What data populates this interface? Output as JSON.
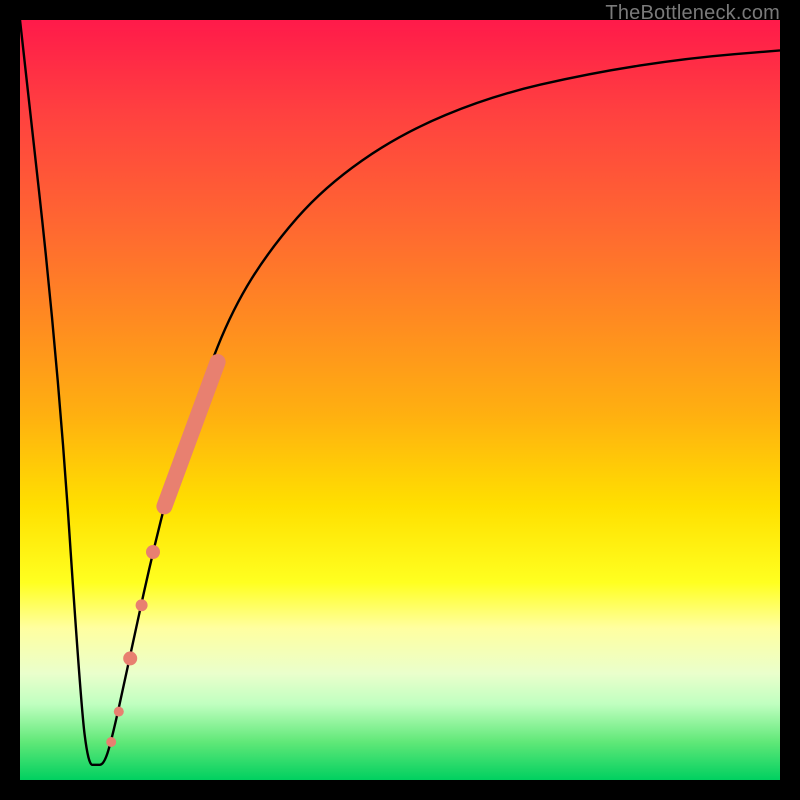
{
  "watermark": {
    "text": "TheBottleneck.com"
  },
  "colors": {
    "curve": "#000000",
    "marker": "#e88070",
    "frame": "#000000"
  },
  "chart_data": {
    "type": "line",
    "title": "",
    "xlabel": "",
    "ylabel": "",
    "xlim": [
      0,
      100
    ],
    "ylim": [
      0,
      100
    ],
    "series": [
      {
        "name": "bottleneck-curve",
        "x": [
          0,
          5,
          8,
          9,
          10,
          11,
          12,
          14,
          17,
          20,
          24,
          28,
          33,
          40,
          50,
          62,
          75,
          88,
          100
        ],
        "y": [
          100,
          55,
          10,
          2,
          2,
          2,
          5,
          14,
          28,
          40,
          52,
          62,
          70,
          78,
          85,
          90,
          93,
          95,
          96
        ]
      }
    ],
    "markers": [
      {
        "name": "segment-a",
        "type": "thick-segment",
        "x": [
          19,
          26
        ],
        "y": [
          36,
          55
        ],
        "r": 8
      },
      {
        "name": "dot-b",
        "type": "dot",
        "x": 17.5,
        "y": 30,
        "r": 7
      },
      {
        "name": "dot-c",
        "type": "dot",
        "x": 16,
        "y": 23,
        "r": 6
      },
      {
        "name": "dot-d",
        "type": "dot",
        "x": 14.5,
        "y": 16,
        "r": 7
      },
      {
        "name": "dot-e",
        "type": "dot",
        "x": 13,
        "y": 9,
        "r": 5
      },
      {
        "name": "dot-f",
        "type": "dot",
        "x": 12,
        "y": 5,
        "r": 5
      }
    ]
  }
}
